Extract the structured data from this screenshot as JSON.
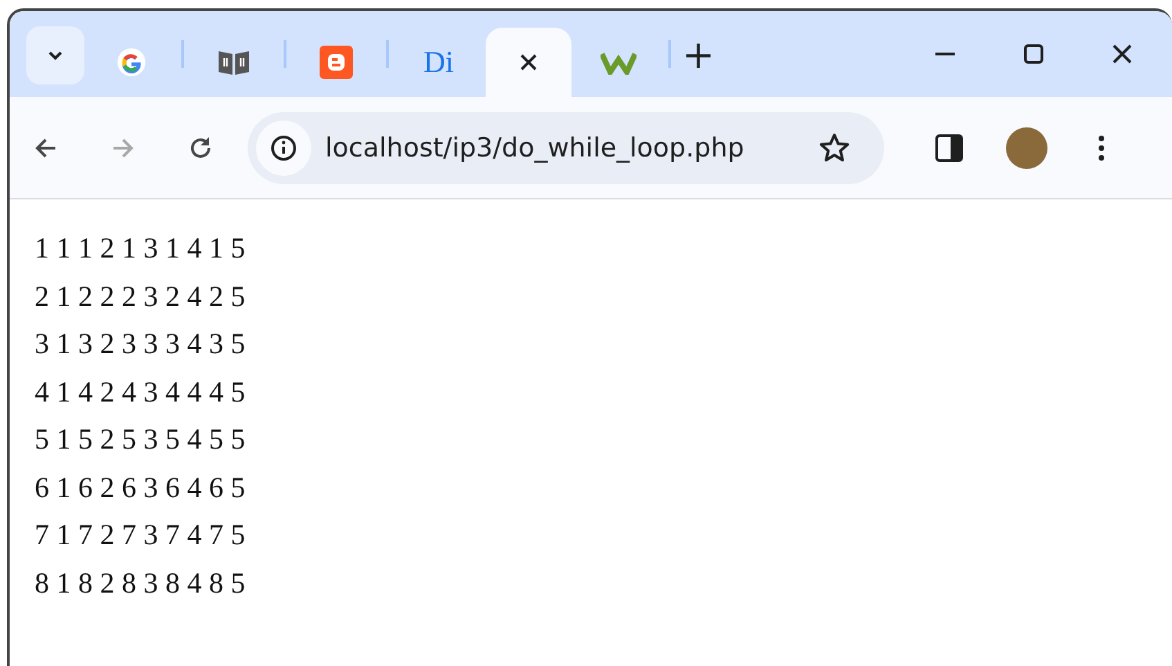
{
  "tabs": [
    {
      "kind": "google",
      "selected": false
    },
    {
      "kind": "book",
      "selected": false
    },
    {
      "kind": "blogger",
      "selected": false
    },
    {
      "kind": "letters",
      "text": "Di",
      "selected": false
    },
    {
      "kind": "blank",
      "selected": true
    },
    {
      "kind": "w",
      "selected": false
    }
  ],
  "new_tab": "+",
  "toolbar": {
    "forward_disabled": true,
    "url": "localhost/ip3/do_while_loop.php"
  },
  "lines": [
    "1 1 1 2 1 3 1 4 1 5",
    "2 1 2 2 2 3 2 4 2 5",
    "3 1 3 2 3 3 3 4 3 5",
    "4 1 4 2 4 3 4 4 4 5",
    "5 1 5 2 5 3 5 4 5 5",
    "6 1 6 2 6 3 6 4 6 5",
    "7 1 7 2 7 3 7 4 7 5",
    "8 1 8 2 8 3 8 4 8 5"
  ]
}
